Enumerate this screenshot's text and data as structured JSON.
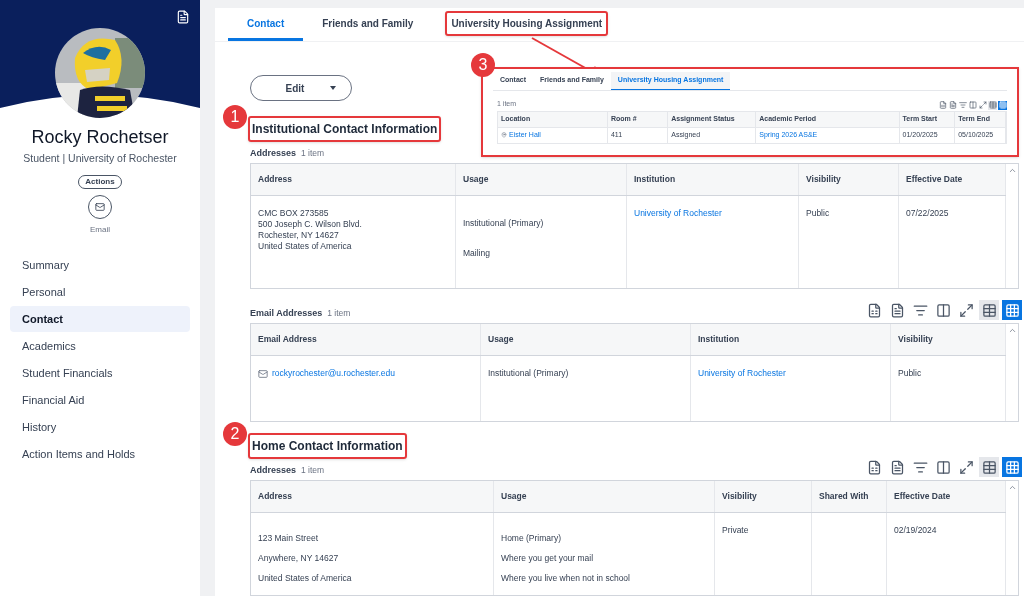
{
  "sidebar": {
    "name": "Rocky Rochetser",
    "subtitle": "Student | University of Rochester",
    "actions_button": "Actions",
    "email_action": "Email",
    "items": [
      {
        "label": "Summary",
        "selected": false
      },
      {
        "label": "Personal",
        "selected": false
      },
      {
        "label": "Contact",
        "selected": true
      },
      {
        "label": "Academics",
        "selected": false
      },
      {
        "label": "Student Financials",
        "selected": false
      },
      {
        "label": "Financial Aid",
        "selected": false
      },
      {
        "label": "History",
        "selected": false
      },
      {
        "label": "Action Items and Holds",
        "selected": false
      }
    ]
  },
  "tabs": [
    {
      "label": "Contact",
      "selected": true,
      "annotated": false
    },
    {
      "label": "Friends and Family",
      "selected": false,
      "annotated": false
    },
    {
      "label": "University Housing Assignment",
      "selected": false,
      "annotated": true
    }
  ],
  "edit_button": "Edit",
  "sections": [
    {
      "title": "Institutional Contact Information",
      "callout": "1",
      "tables": [
        {
          "label": "Addresses",
          "count": "1 item",
          "toolbar": false,
          "columns": [
            "Address",
            "Usage",
            "Institution",
            "Visibility",
            "Effective Date"
          ],
          "rows": [
            [
              {
                "kind": "text",
                "lines": [
                  "CMC BOX 273585",
                  "500 Joseph C. Wilson Blvd.",
                  "Rochester, NY 14627",
                  "United States of America"
                ]
              },
              {
                "kind": "text",
                "lines": [
                  "Institutional (Primary)",
                  "Mailing"
                ]
              },
              {
                "kind": "link",
                "lines": [
                  "University of Rochester"
                ]
              },
              {
                "kind": "text",
                "lines": [
                  "Public"
                ]
              },
              {
                "kind": "text",
                "lines": [
                  "07/22/2025"
                ]
              }
            ]
          ]
        },
        {
          "label": "Email Addresses",
          "count": "1 item",
          "toolbar": true,
          "columns": [
            "Email Address",
            "Usage",
            "Institution",
            "Visibility"
          ],
          "rows": [
            [
              {
                "kind": "email",
                "lines": [
                  "rockyrochester@u.rochester.edu"
                ]
              },
              {
                "kind": "text",
                "lines": [
                  "Institutional (Primary)"
                ]
              },
              {
                "kind": "link",
                "lines": [
                  "University of Rochester"
                ]
              },
              {
                "kind": "text",
                "lines": [
                  "Public"
                ]
              }
            ]
          ]
        }
      ]
    },
    {
      "title": "Home Contact Information",
      "callout": "2",
      "tables": [
        {
          "label": "Addresses",
          "count": "1 item",
          "toolbar": true,
          "columns": [
            "Address",
            "Usage",
            "Visibility",
            "Shared With",
            "Effective Date"
          ],
          "rows": [
            [
              {
                "kind": "text",
                "lines": [
                  "123 Main Street",
                  "Anywhere, NY 14627",
                  "United States of America"
                ]
              },
              {
                "kind": "text",
                "lines": [
                  "Home (Primary)",
                  "Where you get your mail",
                  "Where you live when not in school"
                ]
              },
              {
                "kind": "text",
                "lines": [
                  "Private"
                ]
              },
              {
                "kind": "empty"
              },
              {
                "kind": "text",
                "lines": [
                  "02/19/2024"
                ]
              }
            ]
          ]
        }
      ]
    }
  ],
  "inset": {
    "callout": "3",
    "tabs": [
      {
        "label": "Contact",
        "selected": false
      },
      {
        "label": "Friends and Family",
        "selected": false
      },
      {
        "label": "University Housing Assignment",
        "selected": true
      }
    ],
    "count": "1 item",
    "columns": [
      "Location",
      "Room #",
      "Assignment Status",
      "Academic Period",
      "Term Start",
      "Term End"
    ],
    "row": [
      {
        "kind": "location",
        "text": "Eister Hall"
      },
      {
        "kind": "text",
        "text": "411"
      },
      {
        "kind": "text",
        "text": "Assigned"
      },
      {
        "kind": "link",
        "text": "Spring 2026 AS&E"
      },
      {
        "kind": "text",
        "text": "01/20/2025"
      },
      {
        "kind": "text",
        "text": "05/10/2025"
      }
    ]
  }
}
